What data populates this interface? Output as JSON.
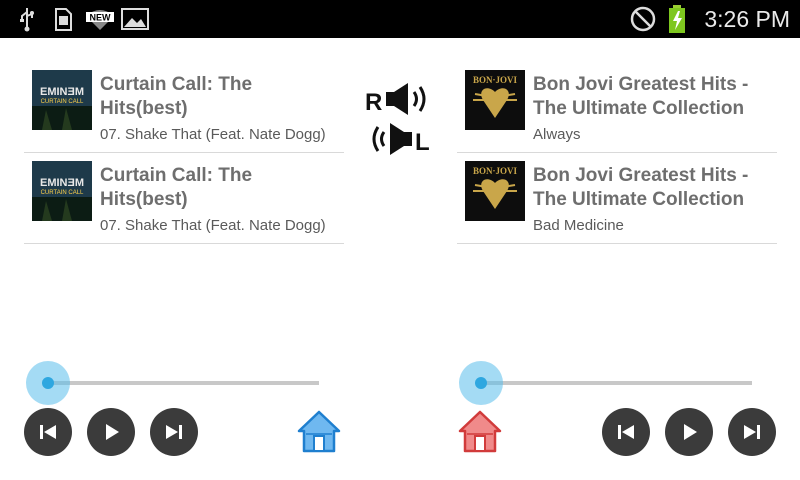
{
  "status_bar": {
    "time": "3:26 PM",
    "icons": [
      "usb-icon",
      "sd-card-icon",
      "wifi-new-icon",
      "gallery-icon",
      "do-not-disturb-icon",
      "battery-charging-icon"
    ],
    "wifi_badge": "NEW"
  },
  "left_player": {
    "tracks": [
      {
        "album": "Curtain Call: The Hits(best)",
        "song": "07. Shake That (Feat. Nate Dogg)",
        "art_text": "EMINƎM",
        "art_subtext": "CURTAIN CALL"
      },
      {
        "album": "Curtain Call: The Hits(best)",
        "song": "07. Shake That (Feat. Nate Dogg)",
        "art_text": "EMINƎM",
        "art_subtext": "CURTAIN CALL"
      }
    ],
    "progress": 0.0,
    "home_color": "#1f7fcf"
  },
  "right_player": {
    "tracks": [
      {
        "album": "Bon Jovi Greatest Hits - The Ultimate Collection",
        "song": "Always",
        "art_text": "BON·JOVI"
      },
      {
        "album": "Bon Jovi Greatest Hits - The Ultimate Collection",
        "song": "Bad Medicine",
        "art_text": "BON·JOVI"
      }
    ],
    "progress": 0.0,
    "home_color": "#d13b3b"
  },
  "swap_control": {
    "label_r": "R",
    "label_l": "L"
  },
  "colors": {
    "accent": "#2ea7e0",
    "button_bg": "#3b3b3b"
  }
}
